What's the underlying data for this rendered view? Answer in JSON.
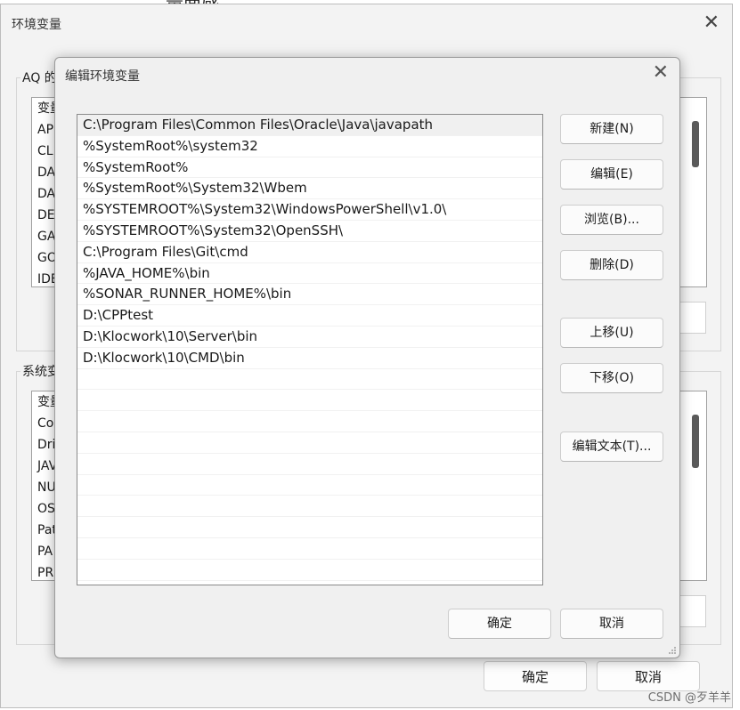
{
  "background": {
    "top_text": "量面感。"
  },
  "outer": {
    "title": "环境变量",
    "user_group_label": "AQ 的",
    "user_list_rows": [
      "变量",
      "AP",
      "CLI",
      "DA",
      "DA",
      "DE",
      "GA",
      "GO",
      "IDE"
    ],
    "system_group_label": "系统变",
    "system_list_rows": [
      "变量",
      "Co",
      "Dri",
      "JAV",
      "NU",
      "OS",
      "Pat",
      "PA",
      "PR"
    ],
    "ok_label": "确定",
    "cancel_label": "取消"
  },
  "dialog": {
    "title": "编辑环境变量",
    "paths": [
      "C:\\Program Files\\Common Files\\Oracle\\Java\\javapath",
      "%SystemRoot%\\system32",
      "%SystemRoot%",
      "%SystemRoot%\\System32\\Wbem",
      "%SYSTEMROOT%\\System32\\WindowsPowerShell\\v1.0\\",
      "%SYSTEMROOT%\\System32\\OpenSSH\\",
      "C:\\Program Files\\Git\\cmd",
      "%JAVA_HOME%\\bin",
      "%SONAR_RUNNER_HOME%\\bin",
      "D:\\CPPtest",
      "D:\\Klocwork\\10\\Server\\bin",
      "D:\\Klocwork\\10\\CMD\\bin"
    ],
    "buttons": {
      "new": "新建(N)",
      "edit": "编辑(E)",
      "browse": "浏览(B)...",
      "delete": "删除(D)",
      "move_up": "上移(U)",
      "move_down": "下移(O)",
      "edit_text": "编辑文本(T)...",
      "ok": "确定",
      "cancel": "取消"
    }
  },
  "watermark": "CSDN @歹羊羊"
}
